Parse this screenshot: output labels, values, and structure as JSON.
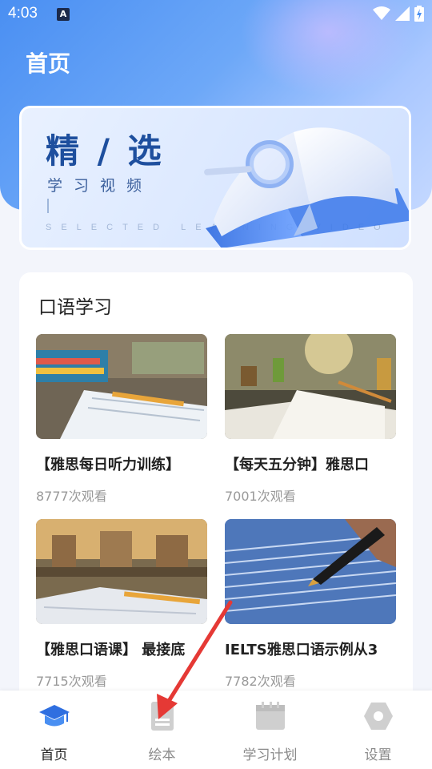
{
  "status_bar": {
    "time": "4:03",
    "notification_badge": "A"
  },
  "header": {
    "title": "首页"
  },
  "banner": {
    "title": "精 / 选",
    "subtitle": "学习视频",
    "english": "SELECTED LEARNING VIDEO"
  },
  "section": {
    "title": "口语学习",
    "videos": [
      {
        "title": "【雅思每日听力训练】",
        "views": "8777次观看"
      },
      {
        "title": "【每天五分钟】雅思口",
        "views": "7001次观看"
      },
      {
        "title": "【雅思口语课】 最接底",
        "views": "7715次观看"
      },
      {
        "title": "IELTS雅思口语示例从3",
        "views": "7782次观看"
      }
    ]
  },
  "tabs": [
    {
      "label": "首页",
      "icon": "graduation-cap-icon",
      "active": true
    },
    {
      "label": "绘本",
      "icon": "book-icon",
      "active": false
    },
    {
      "label": "学习计划",
      "icon": "calendar-icon",
      "active": false
    },
    {
      "label": "设置",
      "icon": "settings-icon",
      "active": false
    }
  ],
  "colors": {
    "primary": "#4a8ff2",
    "annotation_arrow": "#e53935"
  }
}
